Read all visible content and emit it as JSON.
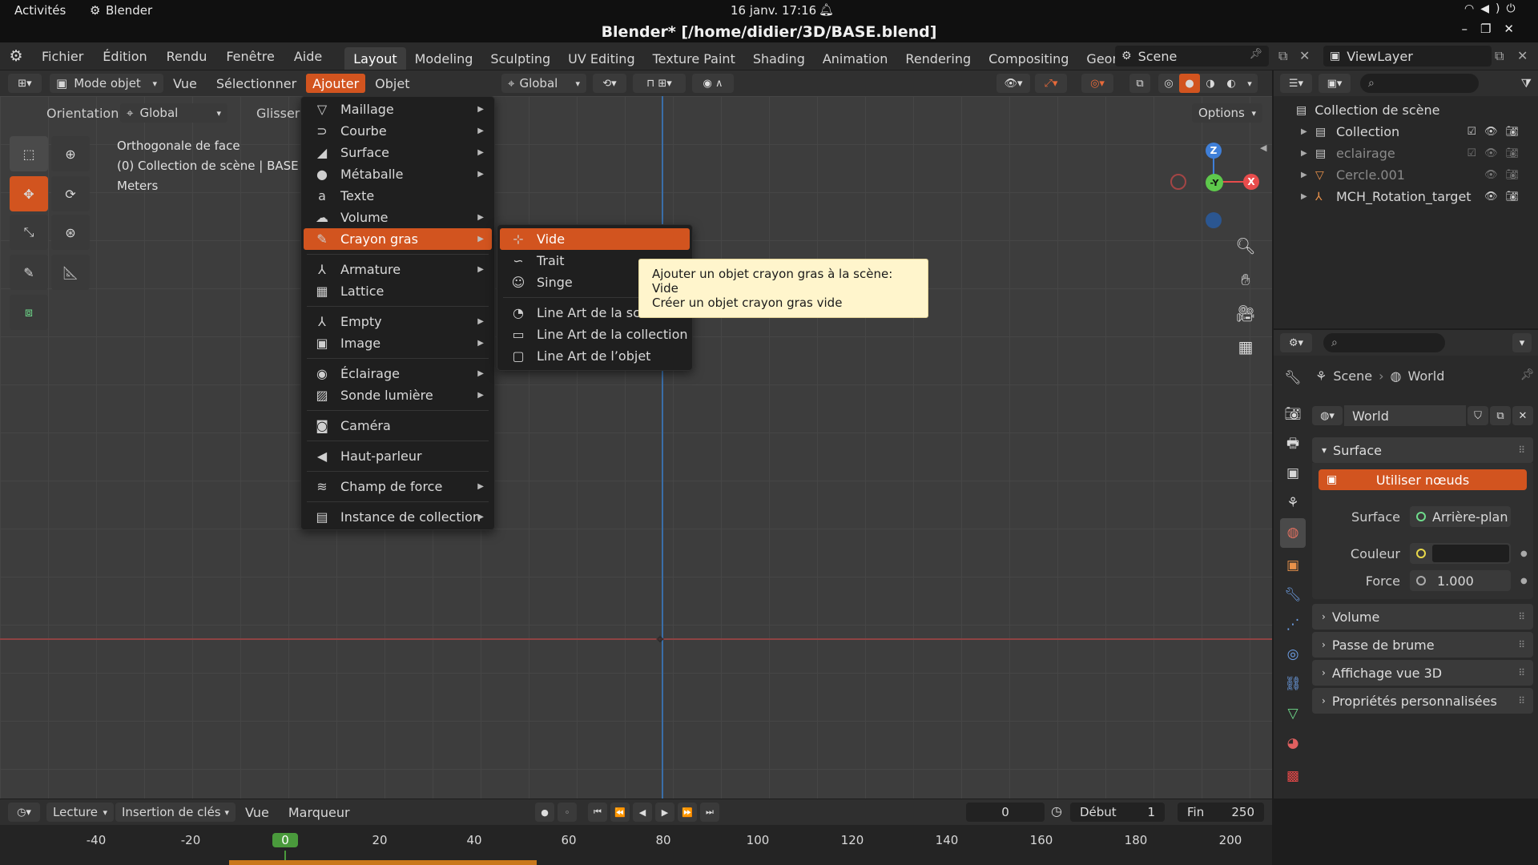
{
  "system": {
    "activities": "Activités",
    "app": "Blender",
    "datetime": "16 janv.  17:16"
  },
  "window": {
    "title": "Blender* [/home/didier/3D/BASE.blend]"
  },
  "menubar": {
    "items": [
      "Fichier",
      "Édition",
      "Rendu",
      "Fenêtre",
      "Aide"
    ]
  },
  "workspaces": {
    "tabs": [
      "Layout",
      "Modeling",
      "Sculpting",
      "UV Editing",
      "Texture Paint",
      "Shading",
      "Animation",
      "Rendering",
      "Compositing",
      "Geometry N"
    ],
    "active": "Layout"
  },
  "scene": {
    "name": "Scene",
    "viewlayer": "ViewLayer"
  },
  "viewport_header": {
    "mode": "Mode objet",
    "vue": "Vue",
    "select": "Sélectionner",
    "add": "Ajouter",
    "object": "Objet",
    "transform": "Global"
  },
  "toolsettings": {
    "orientation_label": "Orientation:",
    "orientation_value": "Global",
    "drag": "Glisser",
    "options": "Options"
  },
  "overlay": {
    "line1": "Orthogonale de face",
    "line2": "(0) Collection de scène | BASE",
    "line3": "Meters"
  },
  "gizmo": {
    "z": "Z",
    "y": "-Y",
    "x": "X"
  },
  "add_menu": [
    {
      "label": "Maillage",
      "icon": "▽",
      "sub": true
    },
    {
      "label": "Courbe",
      "icon": "⊃",
      "sub": true
    },
    {
      "label": "Surface",
      "icon": "◢",
      "sub": true
    },
    {
      "label": "Métaballe",
      "icon": "●",
      "sub": true
    },
    {
      "label": "Texte",
      "icon": "a",
      "sub": false
    },
    {
      "label": "Volume",
      "icon": "☁",
      "sub": true
    },
    {
      "label": "Crayon gras",
      "icon": "✎",
      "sub": true,
      "hl": true
    },
    {
      "sep": true
    },
    {
      "label": "Armature",
      "icon": "⅄",
      "sub": true
    },
    {
      "label": "Lattice",
      "icon": "▦",
      "sub": false
    },
    {
      "sep": true
    },
    {
      "label": "Empty",
      "icon": "⅄",
      "sub": true
    },
    {
      "label": "Image",
      "icon": "▣",
      "sub": true
    },
    {
      "sep": true
    },
    {
      "label": "Éclairage",
      "icon": "◉",
      "sub": true
    },
    {
      "label": "Sonde lumière",
      "icon": "▨",
      "sub": true
    },
    {
      "sep": true
    },
    {
      "label": "Caméra",
      "icon": "◙",
      "sub": false
    },
    {
      "sep": true
    },
    {
      "label": "Haut-parleur",
      "icon": "◀",
      "sub": false
    },
    {
      "sep": true
    },
    {
      "label": "Champ de force",
      "icon": "≋",
      "sub": true
    },
    {
      "sep": true
    },
    {
      "label": "Instance de collection",
      "icon": "▤",
      "sub": true
    }
  ],
  "gp_menu": [
    {
      "label": "Vide",
      "icon": "⊹",
      "hl": true
    },
    {
      "label": "Trait",
      "icon": "∽"
    },
    {
      "label": "Singe",
      "icon": "☺"
    },
    {
      "sep": true
    },
    {
      "label": "Line Art de la scène",
      "icon": "◔"
    },
    {
      "label": "Line Art de la collection",
      "icon": "▭"
    },
    {
      "label": "Line Art de l’objet",
      "icon": "▢"
    }
  ],
  "tooltip": {
    "line1_prefix": "Ajouter un objet crayon gras à la scène:",
    "line1_value": "Vide",
    "line2": "Créer un objet crayon gras vide"
  },
  "outliner": {
    "root": "Collection de scène",
    "rows": [
      {
        "label": "Collection",
        "dim": false
      },
      {
        "label": "eclairage",
        "dim": true
      },
      {
        "label": "Cercle.001",
        "dim": true
      },
      {
        "label": "MCH_Rotation_target",
        "dim": false
      }
    ]
  },
  "properties": {
    "breadcrumb_scene": "Scene",
    "breadcrumb_world": "World",
    "world_name": "World",
    "surface_panel": "Surface",
    "use_nodes": "Utiliser nœuds",
    "surface_label": "Surface",
    "surface_value": "Arrière-plan",
    "color_label": "Couleur",
    "strength_label": "Force",
    "strength_value": "1.000",
    "panels": [
      "Volume",
      "Passe de brume",
      "Affichage vue 3D",
      "Propriétés personnalisées"
    ]
  },
  "timeline": {
    "playback": "Lecture",
    "keying": "Insertion de clés",
    "view": "Vue",
    "marker": "Marqueur",
    "current_frame": "0",
    "start_label": "Début",
    "start": "1",
    "end_label": "Fin",
    "end": "250",
    "ticks": [
      "-40",
      "-20",
      "0",
      "20",
      "40",
      "60",
      "80",
      "100",
      "120",
      "140",
      "160",
      "180",
      "200"
    ]
  },
  "colors": {
    "accent": "#d2541f",
    "tooltip_bg": "#fff5cc",
    "x_axis": "#e84c4c",
    "y_axis": "#5ec84c",
    "z_axis": "#3f7fd8"
  }
}
